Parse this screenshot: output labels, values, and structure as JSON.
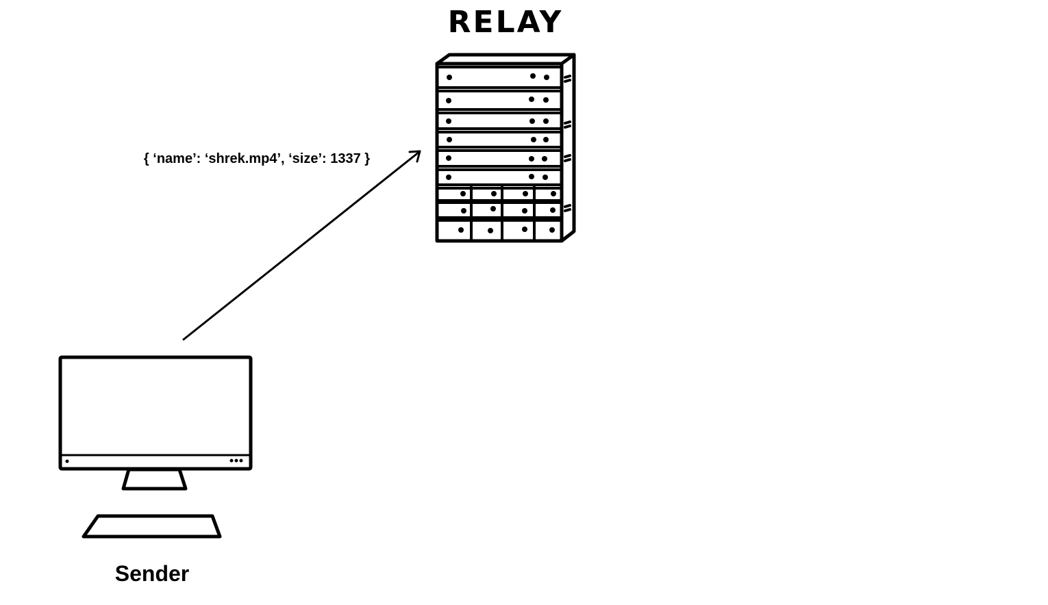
{
  "relay": {
    "title": "RELAY",
    "icon": "server-rack-icon"
  },
  "sender": {
    "label": "Sender",
    "icon": "desktop-computer-icon"
  },
  "message": {
    "text": "{ ‘name’: ‘shrek.mp4’, ‘size’: 1337 }"
  },
  "colors": {
    "stroke": "#000000",
    "background": "#ffffff"
  }
}
